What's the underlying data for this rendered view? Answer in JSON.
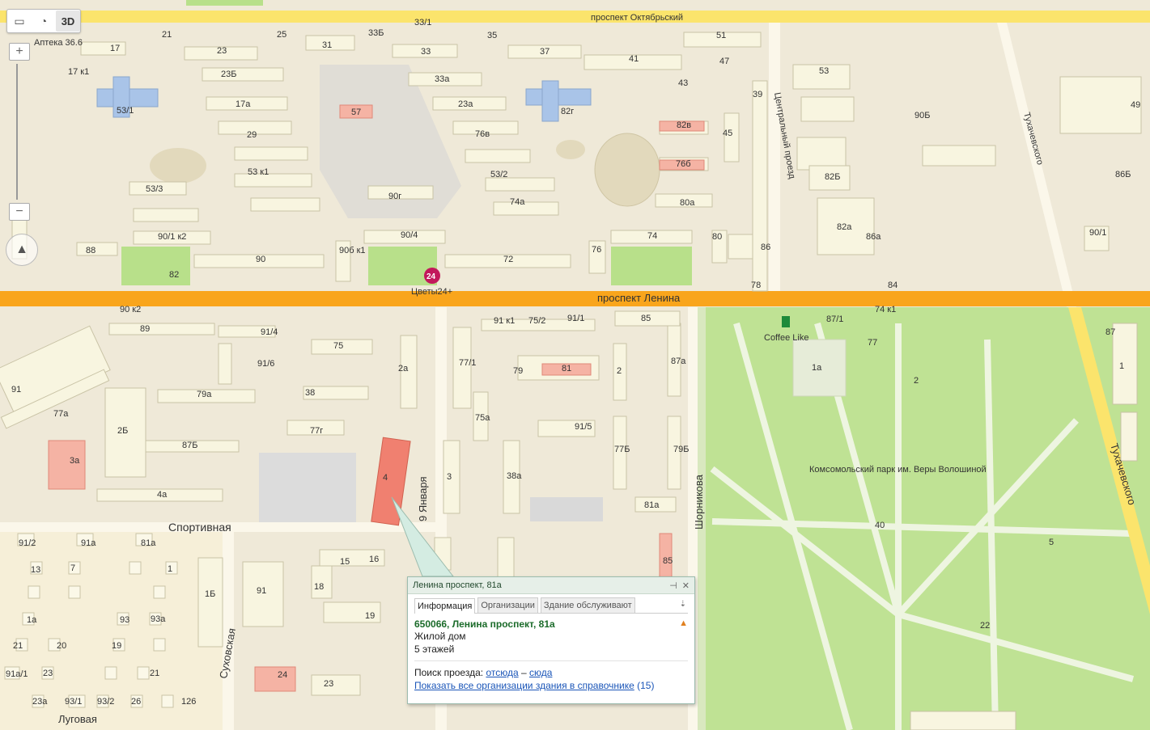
{
  "streets": {
    "oktyabrsky": "проспект Октябрьский",
    "lenina": "проспект Ленина",
    "yanvarya": "9 Января",
    "shornikova": "Шорникова",
    "sportivnaya": "Спортивная",
    "tsentralny": "Центральный проезд",
    "tukhachevskogo_top": "Тухачевского",
    "tukhachevskogo_right": "Тухачевского",
    "sukhovskaya": "Суховская",
    "lugovaya": "Луговая"
  },
  "pois": {
    "apteka": "Аптека 36.6",
    "cvety": "Цветы24+",
    "cvety_badge": "24",
    "coffee": "Coffee Like",
    "park": "Комсомольский парк им. Веры Волошиной"
  },
  "buildings": [
    "33/1",
    "21",
    "25",
    "31",
    "33Б",
    "35",
    "51",
    "17",
    "23",
    "33",
    "37",
    "17 к1",
    "23Б",
    "33а",
    "41",
    "47",
    "43",
    "53",
    "53/1",
    "17а",
    "23а",
    "82г",
    "39",
    "49",
    "57",
    "29",
    "76в",
    "82в",
    "45",
    "90Б",
    "53 к1",
    "53/2",
    "76б",
    "82Б",
    "86Б",
    "53/3",
    "90г",
    "74а",
    "80а",
    "82а",
    "86а",
    "90/1",
    "90/1 к2",
    "90/4",
    "74",
    "80",
    "86",
    "88",
    "90",
    "90б к1",
    "72",
    "76",
    "78",
    "82",
    "84",
    "90 к2",
    "74 к1",
    "91 к1",
    "75/2",
    "91/1",
    "85",
    "87/1",
    "87",
    "89",
    "91/4",
    "75",
    "77",
    "79",
    "91/6",
    "2а",
    "77/1",
    "81",
    "2",
    "87а",
    "1а",
    "1",
    "91",
    "2",
    "75а",
    "91/5",
    "77а",
    "79а",
    "38",
    "2Б",
    "87Б",
    "77г",
    "77Б",
    "79Б",
    "3а",
    "3",
    "38а",
    "4",
    "4а",
    "81а",
    "40",
    "5",
    "91/2",
    "91а",
    "81а",
    "85",
    "13",
    "7",
    "15",
    "16",
    "1",
    "1Б",
    "18",
    "19",
    "91",
    "93а",
    "1а",
    "93",
    "20",
    "21",
    "19",
    "22",
    "23",
    "21",
    "91а/1",
    "24",
    "23",
    "23а",
    "93/1",
    "93/2",
    "26",
    "126",
    "25",
    "26",
    "25"
  ],
  "controls": {
    "btn_3d": "3D",
    "zoom_in": "+",
    "zoom_out": "−"
  },
  "popup": {
    "title": "Ленина проспект, 81а",
    "tabs": [
      "Информация",
      "Организации",
      "Здание обслуживают"
    ],
    "address": "650066, Ленина проспект, 81а",
    "type": "Жилой дом",
    "floors": "5 этажей",
    "route_label": "Поиск проезда:",
    "route_from": "отсюда",
    "route_dash": "–",
    "route_to": "сюда",
    "orgs_link": "Показать все организации здания в справочнике",
    "orgs_count": "(15)"
  },
  "colors": {
    "main_road": "#f9a51c",
    "secondary_road": "#fbe46c",
    "park": "#b8e08a",
    "building": "#f8f5e0",
    "highlight": "#f08070",
    "school": "#a9c4e8"
  }
}
